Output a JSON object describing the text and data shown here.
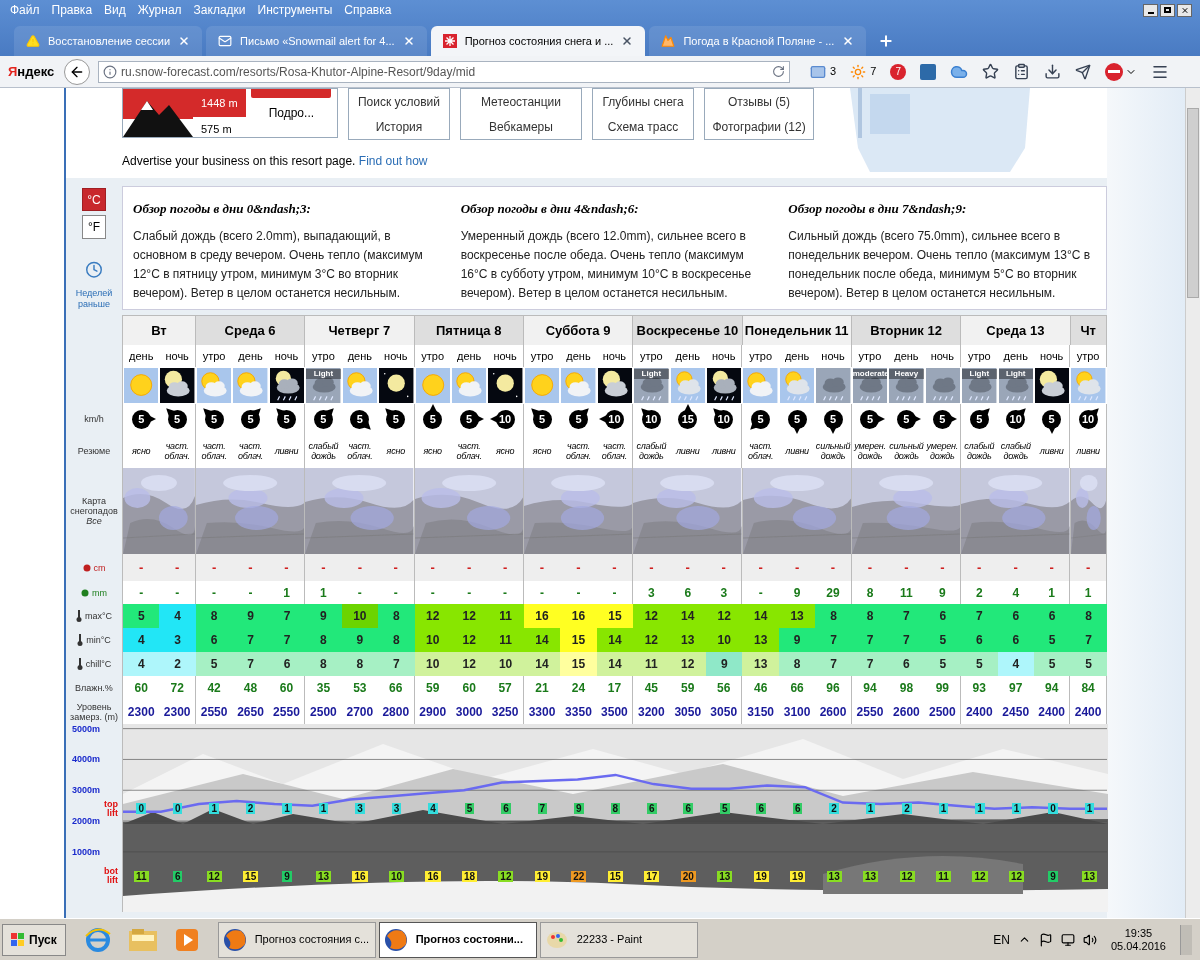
{
  "browser": {
    "menu": [
      "Файл",
      "Правка",
      "Вид",
      "Журнал",
      "Закладки",
      "Инструменты",
      "Справка"
    ],
    "tabs": [
      {
        "title": "Восстановление сессии",
        "selected": false
      },
      {
        "title": "Письмо «Snowmail alert for 4...",
        "selected": false
      },
      {
        "title": "Прогноз состояния снега и ...",
        "selected": true
      },
      {
        "title": "Погода в Красной Поляне - ...",
        "selected": false
      }
    ],
    "brand": "Яндекс",
    "url": "ru.snow-forecast.com/resorts/Rosa-Khutor-Alpine-Resort/9day/mid",
    "mail_count": "3",
    "weather_temp": "7",
    "notification_count": "7"
  },
  "resort": {
    "top_height": "1448 m",
    "bottom_height": "575 m",
    "more_link": "Подро...",
    "nav_boxes": [
      [
        "Поиск условий",
        "История"
      ],
      [
        "Метеостанции",
        "Вебкамеры"
      ],
      [
        "Глубины снега",
        "Схема трасс"
      ],
      [
        "Отзывы (5)",
        "Фотографии (12)"
      ]
    ],
    "advertise": "Advertise your business on this resort page.",
    "advertise_link": "Find out how"
  },
  "units": [
    {
      "label": "°C",
      "selected": true
    },
    {
      "label": "°F",
      "selected": false
    }
  ],
  "earlier_link": "Неделей раньше",
  "overview": [
    {
      "title": "Обзор погоды в дни 0&ndash;3:",
      "text": "Слабый дождь (всего 2.0mm), выпадающий, в основном в среду вечером. Очень тепло (максимум 12°C в пятницу утром, минимум 3°C во вторник вечером). Ветер в целом останется несильным."
    },
    {
      "title": "Обзор погоды в дни 4&ndash;6:",
      "text": "Умеренный дождь (всего 12.0mm), сильнее всего в воскресенье после обеда. Очень тепло (максимум 16°C в субботу утром, минимум 10°C в воскресенье вечером). Ветер в целом останется несильным."
    },
    {
      "title": "Обзор погоды в дни 7&ndash;9:",
      "text": "Сильный дождь (всего 75.0mm), сильнее всего в понедельник вечером. Очень тепло (максимум 13°C в понедельник после обеда, минимум 5°C во вторник вечером). Ветер в целом останется несильным."
    }
  ],
  "row_labels": {
    "wind": "km/h",
    "summary": "Резюме",
    "map": "Карта снегопадов",
    "map_link": "Все",
    "snow": "cm",
    "rain": "mm",
    "max": "max°C",
    "min": "min°C",
    "chill": "chill°C",
    "humidity": "Влажн.%",
    "freezing": "Уровень замерз. (m)"
  },
  "days": [
    {
      "name": "Вт",
      "slots": [
        {
          "period": "день",
          "kind": "sun",
          "wind": {
            "value": "5",
            "kind": "e"
          },
          "summary": "ясно",
          "snow": "-",
          "rain": "-",
          "max": {
            "value": "5",
            "color": "#22e87a"
          },
          "min": {
            "value": "4",
            "color": "#22e6f6"
          },
          "chill": {
            "value": "4",
            "color": "#aef6fb"
          },
          "humidity": "60",
          "freezing": "2300",
          "top_lift": {
            "value": "0",
            "color": "#33dddd"
          },
          "bot_lift": {
            "value": "11",
            "color": "#88dd22"
          }
        },
        {
          "period": "ночь",
          "kind": "moon_cloud",
          "wind": {
            "value": "5",
            "kind": "nw"
          },
          "summary": "част. облач.",
          "snow": "-",
          "rain": "-",
          "max": {
            "value": "4",
            "color": "#22e6f6"
          },
          "min": {
            "value": "3",
            "color": "#22e6f6"
          },
          "chill": {
            "value": "2",
            "color": "#aef6fb"
          },
          "humidity": "72",
          "freezing": "2300",
          "top_lift": {
            "value": "0",
            "color": "#33dddd"
          },
          "bot_lift": {
            "value": "6",
            "color": "#22cc66"
          }
        }
      ]
    },
    {
      "name": "Среда 6",
      "slots": [
        {
          "period": "утро",
          "kind": "sun_cloud",
          "wind": {
            "value": "5",
            "kind": "nw"
          },
          "summary": "част. облач.",
          "snow": "-",
          "rain": "-",
          "max": {
            "value": "8",
            "color": "#22e87a"
          },
          "min": {
            "value": "6",
            "color": "#22e87a"
          },
          "chill": {
            "value": "5",
            "color": "#a6f0c4"
          },
          "humidity": "42",
          "freezing": "2550",
          "top_lift": {
            "value": "1",
            "color": "#33dddd"
          },
          "bot_lift": {
            "value": "12",
            "color": "#88dd22"
          }
        },
        {
          "period": "день",
          "kind": "sun_cloud",
          "wind": {
            "value": "5",
            "kind": "ne"
          },
          "summary": "част. облач.",
          "snow": "-",
          "rain": "-",
          "max": {
            "value": "9",
            "color": "#22e87a"
          },
          "min": {
            "value": "7",
            "color": "#22e87a"
          },
          "chill": {
            "value": "7",
            "color": "#a6f0c4"
          },
          "humidity": "48",
          "freezing": "2650",
          "top_lift": {
            "value": "2",
            "color": "#33dddd"
          },
          "bot_lift": {
            "value": "15",
            "color": "#ffee33"
          }
        },
        {
          "period": "ночь",
          "kind": "moon_rain",
          "wind": {
            "value": "5",
            "kind": "nw"
          },
          "summary": "ливни",
          "snow": "-",
          "rain": "1",
          "max": {
            "value": "7",
            "color": "#22e87a"
          },
          "min": {
            "value": "7",
            "color": "#22e87a"
          },
          "chill": {
            "value": "6",
            "color": "#a6f0c4"
          },
          "humidity": "60",
          "freezing": "2550",
          "top_lift": {
            "value": "1",
            "color": "#33dddd"
          },
          "bot_lift": {
            "value": "9",
            "color": "#22cc66"
          }
        }
      ]
    },
    {
      "name": "Четверг 7",
      "slots": [
        {
          "period": "утро",
          "kind": "cloud_rain",
          "label": "Light",
          "wind": {
            "value": "5",
            "kind": "ne"
          },
          "summary": "слабый дождь",
          "snow": "-",
          "rain": "1",
          "max": {
            "value": "9",
            "color": "#22e87a"
          },
          "min": {
            "value": "8",
            "color": "#22e87a"
          },
          "chill": {
            "value": "8",
            "color": "#a6f0c4"
          },
          "humidity": "35",
          "freezing": "2500",
          "top_lift": {
            "value": "1",
            "color": "#33dddd"
          },
          "bot_lift": {
            "value": "13",
            "color": "#88dd22"
          }
        },
        {
          "period": "день",
          "kind": "sun_cloud",
          "wind": {
            "value": "5",
            "kind": "se"
          },
          "summary": "част. облач.",
          "snow": "-",
          "rain": "-",
          "max": {
            "value": "10",
            "color": "#6cd400"
          },
          "min": {
            "value": "9",
            "color": "#22e87a"
          },
          "chill": {
            "value": "8",
            "color": "#a6f0c4"
          },
          "humidity": "53",
          "freezing": "2700",
          "top_lift": {
            "value": "3",
            "color": "#33dddd"
          },
          "bot_lift": {
            "value": "16",
            "color": "#ffee33"
          }
        },
        {
          "period": "ночь",
          "kind": "moon",
          "wind": {
            "value": "5",
            "kind": "nw"
          },
          "summary": "ясно",
          "snow": "-",
          "rain": "-",
          "max": {
            "value": "8",
            "color": "#22e87a"
          },
          "min": {
            "value": "8",
            "color": "#22e87a"
          },
          "chill": {
            "value": "7",
            "color": "#a6f0c4"
          },
          "humidity": "66",
          "freezing": "2800",
          "top_lift": {
            "value": "3",
            "color": "#33dddd"
          },
          "bot_lift": {
            "value": "10",
            "color": "#88dd22"
          }
        }
      ]
    },
    {
      "name": "Пятница 8",
      "slots": [
        {
          "period": "утро",
          "kind": "sun",
          "wind": {
            "value": "5",
            "kind": "n"
          },
          "summary": "ясно",
          "snow": "-",
          "rain": "-",
          "max": {
            "value": "12",
            "color": "#88e600"
          },
          "min": {
            "value": "10",
            "color": "#88e600"
          },
          "chill": {
            "value": "10",
            "color": "#d0f29c"
          },
          "humidity": "59",
          "freezing": "2900",
          "top_lift": {
            "value": "4",
            "color": "#33dddd"
          },
          "bot_lift": {
            "value": "16",
            "color": "#ffee33"
          }
        },
        {
          "period": "день",
          "kind": "sun_cloud",
          "wind": {
            "value": "5",
            "kind": "e"
          },
          "summary": "част. облач.",
          "snow": "-",
          "rain": "-",
          "max": {
            "value": "12",
            "color": "#88e600"
          },
          "min": {
            "value": "12",
            "color": "#88e600"
          },
          "chill": {
            "value": "12",
            "color": "#d0f29c"
          },
          "humidity": "60",
          "freezing": "3000",
          "top_lift": {
            "value": "5",
            "color": "#33cc66"
          },
          "bot_lift": {
            "value": "18",
            "color": "#ffee33"
          }
        },
        {
          "period": "ночь",
          "kind": "moon",
          "wind": {
            "value": "10",
            "kind": "w"
          },
          "summary": "ясно",
          "snow": "-",
          "rain": "-",
          "max": {
            "value": "11",
            "color": "#88e600"
          },
          "min": {
            "value": "11",
            "color": "#88e600"
          },
          "chill": {
            "value": "10",
            "color": "#d0f29c"
          },
          "humidity": "57",
          "freezing": "3250",
          "top_lift": {
            "value": "6",
            "color": "#33cc66"
          },
          "bot_lift": {
            "value": "12",
            "color": "#88dd22"
          }
        }
      ]
    },
    {
      "name": "Суббота 9",
      "slots": [
        {
          "period": "утро",
          "kind": "sun",
          "wind": {
            "value": "5",
            "kind": "nw"
          },
          "summary": "ясно",
          "snow": "-",
          "rain": "-",
          "max": {
            "value": "16",
            "color": "#ffff22"
          },
          "min": {
            "value": "14",
            "color": "#88e600"
          },
          "chill": {
            "value": "14",
            "color": "#d0f29c"
          },
          "humidity": "21",
          "freezing": "3300",
          "top_lift": {
            "value": "7",
            "color": "#33cc66"
          },
          "bot_lift": {
            "value": "19",
            "color": "#ffee33"
          }
        },
        {
          "period": "день",
          "kind": "sun_cloud",
          "wind": {
            "value": "5",
            "kind": "ne"
          },
          "summary": "част. облач.",
          "snow": "-",
          "rain": "-",
          "max": {
            "value": "16",
            "color": "#ffff22"
          },
          "min": {
            "value": "15",
            "color": "#ffff22"
          },
          "chill": {
            "value": "15",
            "color": "#ffff9e"
          },
          "humidity": "24",
          "freezing": "3350",
          "top_lift": {
            "value": "9",
            "color": "#33cc66"
          },
          "bot_lift": {
            "value": "22",
            "color": "#ee9922"
          }
        },
        {
          "period": "ночь",
          "kind": "moon_cloud",
          "wind": {
            "value": "10",
            "kind": "w"
          },
          "summary": "част. облач.",
          "snow": "-",
          "rain": "-",
          "max": {
            "value": "15",
            "color": "#ffff22"
          },
          "min": {
            "value": "14",
            "color": "#88e600"
          },
          "chill": {
            "value": "14",
            "color": "#d0f29c"
          },
          "humidity": "17",
          "freezing": "3500",
          "top_lift": {
            "value": "8",
            "color": "#33cc66"
          },
          "bot_lift": {
            "value": "15",
            "color": "#ffee33"
          }
        }
      ]
    },
    {
      "name": "Воскресенье 10",
      "slots": [
        {
          "period": "утро",
          "kind": "cloud_rain",
          "label": "Light",
          "wind": {
            "value": "10",
            "kind": "nw"
          },
          "summary": "слабый дождь",
          "snow": "-",
          "rain": "3",
          "max": {
            "value": "12",
            "color": "#88e600"
          },
          "min": {
            "value": "12",
            "color": "#88e600"
          },
          "chill": {
            "value": "11",
            "color": "#d0f29c"
          },
          "humidity": "45",
          "freezing": "3200",
          "top_lift": {
            "value": "6",
            "color": "#33cc66"
          },
          "bot_lift": {
            "value": "17",
            "color": "#ffee33"
          }
        },
        {
          "period": "день",
          "kind": "sun_rain",
          "wind": {
            "value": "15",
            "kind": "n"
          },
          "summary": "ливни",
          "snow": "-",
          "rain": "6",
          "max": {
            "value": "14",
            "color": "#88e600"
          },
          "min": {
            "value": "13",
            "color": "#88e600"
          },
          "chill": {
            "value": "12",
            "color": "#d0f29c"
          },
          "humidity": "59",
          "freezing": "3050",
          "top_lift": {
            "value": "6",
            "color": "#33cc66"
          },
          "bot_lift": {
            "value": "20",
            "color": "#ee9922"
          }
        },
        {
          "period": "ночь",
          "kind": "moon_rain",
          "wind": {
            "value": "10",
            "kind": "nw"
          },
          "summary": "ливни",
          "snow": "-",
          "rain": "3",
          "max": {
            "value": "12",
            "color": "#88e600"
          },
          "min": {
            "value": "10",
            "color": "#88e600"
          },
          "chill": {
            "value": "9",
            "color": "#8fe8c8"
          },
          "humidity": "56",
          "freezing": "3050",
          "top_lift": {
            "value": "5",
            "color": "#33cc66"
          },
          "bot_lift": {
            "value": "13",
            "color": "#88dd22"
          }
        }
      ]
    },
    {
      "name": "Понедельник 11",
      "slots": [
        {
          "period": "утро",
          "kind": "sun_cloud",
          "wind": {
            "value": "5",
            "kind": "sw"
          },
          "summary": "част. облач.",
          "snow": "-",
          "rain": "-",
          "max": {
            "value": "14",
            "color": "#88e600"
          },
          "min": {
            "value": "13",
            "color": "#88e600"
          },
          "chill": {
            "value": "13",
            "color": "#d0f29c"
          },
          "humidity": "46",
          "freezing": "3150",
          "top_lift": {
            "value": "6",
            "color": "#33cc66"
          },
          "bot_lift": {
            "value": "19",
            "color": "#ffee33"
          }
        },
        {
          "period": "день",
          "kind": "sun_rain",
          "wind": {
            "value": "5",
            "kind": "s"
          },
          "summary": "ливни",
          "snow": "-",
          "rain": "9",
          "max": {
            "value": "13",
            "color": "#88e600"
          },
          "min": {
            "value": "9",
            "color": "#22e87a"
          },
          "chill": {
            "value": "8",
            "color": "#a6f0c4"
          },
          "humidity": "66",
          "freezing": "3100",
          "top_lift": {
            "value": "6",
            "color": "#33cc66"
          },
          "bot_lift": {
            "value": "19",
            "color": "#ffee33"
          }
        },
        {
          "period": "ночь",
          "kind": "cloud_rain",
          "wind": {
            "value": "5",
            "kind": "s"
          },
          "summary": "сильный дождь",
          "snow": "-",
          "rain": "29",
          "max": {
            "value": "8",
            "color": "#22e87a"
          },
          "min": {
            "value": "7",
            "color": "#22e87a"
          },
          "chill": {
            "value": "7",
            "color": "#a6f0c4"
          },
          "humidity": "96",
          "freezing": "2600",
          "top_lift": {
            "value": "2",
            "color": "#33dddd"
          },
          "bot_lift": {
            "value": "13",
            "color": "#88dd22"
          }
        }
      ]
    },
    {
      "name": "Вторник 12",
      "slots": [
        {
          "period": "утро",
          "kind": "cloud_rain",
          "label": "moderate",
          "wind": {
            "value": "5",
            "kind": "e"
          },
          "summary": "умерен. дождь",
          "snow": "-",
          "rain": "8",
          "max": {
            "value": "8",
            "color": "#22e87a"
          },
          "min": {
            "value": "7",
            "color": "#22e87a"
          },
          "chill": {
            "value": "7",
            "color": "#a6f0c4"
          },
          "humidity": "94",
          "freezing": "2550",
          "top_lift": {
            "value": "1",
            "color": "#33dddd"
          },
          "bot_lift": {
            "value": "13",
            "color": "#88dd22"
          }
        },
        {
          "period": "день",
          "kind": "cloud_rain",
          "label": "Heavy",
          "wind": {
            "value": "5",
            "kind": "e"
          },
          "summary": "сильный дождь",
          "snow": "-",
          "rain": "11",
          "max": {
            "value": "7",
            "color": "#22e87a"
          },
          "min": {
            "value": "7",
            "color": "#22e87a"
          },
          "chill": {
            "value": "6",
            "color": "#a6f0c4"
          },
          "humidity": "98",
          "freezing": "2600",
          "top_lift": {
            "value": "2",
            "color": "#33dddd"
          },
          "bot_lift": {
            "value": "12",
            "color": "#88dd22"
          }
        },
        {
          "period": "ночь",
          "kind": "cloud_rain",
          "wind": {
            "value": "5",
            "kind": "e"
          },
          "summary": "умерен. дождь",
          "snow": "-",
          "rain": "9",
          "max": {
            "value": "6",
            "color": "#22e87a"
          },
          "min": {
            "value": "5",
            "color": "#22e87a"
          },
          "chill": {
            "value": "5",
            "color": "#a6f0c4"
          },
          "humidity": "99",
          "freezing": "2500",
          "top_lift": {
            "value": "1",
            "color": "#33dddd"
          },
          "bot_lift": {
            "value": "11",
            "color": "#88dd22"
          }
        }
      ]
    },
    {
      "name": "Среда 13",
      "slots": [
        {
          "period": "утро",
          "kind": "cloud_rain",
          "label": "Light",
          "wind": {
            "value": "5",
            "kind": "ne"
          },
          "summary": "слабый дождь",
          "snow": "-",
          "rain": "2",
          "max": {
            "value": "7",
            "color": "#22e87a"
          },
          "min": {
            "value": "6",
            "color": "#22e87a"
          },
          "chill": {
            "value": "5",
            "color": "#a6f0c4"
          },
          "humidity": "93",
          "freezing": "2400",
          "top_lift": {
            "value": "1",
            "color": "#33dddd"
          },
          "bot_lift": {
            "value": "12",
            "color": "#88dd22"
          }
        },
        {
          "period": "день",
          "kind": "cloud_rain",
          "label": "Light",
          "wind": {
            "value": "10",
            "kind": "ne"
          },
          "summary": "слабый дождь",
          "snow": "-",
          "rain": "4",
          "max": {
            "value": "6",
            "color": "#22e87a"
          },
          "min": {
            "value": "6",
            "color": "#22e87a"
          },
          "chill": {
            "value": "4",
            "color": "#aef6fb"
          },
          "humidity": "97",
          "freezing": "2450",
          "top_lift": {
            "value": "1",
            "color": "#33dddd"
          },
          "bot_lift": {
            "value": "12",
            "color": "#88dd22"
          }
        },
        {
          "period": "ночь",
          "kind": "moon_cloud",
          "wind": {
            "value": "5",
            "kind": "s"
          },
          "summary": "ливни",
          "snow": "-",
          "rain": "1",
          "max": {
            "value": "6",
            "color": "#22e87a"
          },
          "min": {
            "value": "5",
            "color": "#22e87a"
          },
          "chill": {
            "value": "5",
            "color": "#a6f0c4"
          },
          "humidity": "94",
          "freezing": "2400",
          "top_lift": {
            "value": "0",
            "color": "#33dddd"
          },
          "bot_lift": {
            "value": "9",
            "color": "#22cc66"
          }
        }
      ]
    },
    {
      "name": "Чт",
      "slots": [
        {
          "period": "утро",
          "kind": "sun_rain",
          "wind": {
            "value": "10",
            "kind": "ne"
          },
          "summary": "ливни",
          "snow": "-",
          "rain": "1",
          "max": {
            "value": "8",
            "color": "#22e87a"
          },
          "min": {
            "value": "7",
            "color": "#22e87a"
          },
          "chill": {
            "value": "5",
            "color": "#a6f0c4"
          },
          "humidity": "84",
          "freezing": "2400",
          "top_lift": {
            "value": "1",
            "color": "#33dddd"
          },
          "bot_lift": {
            "value": "13",
            "color": "#88dd22"
          }
        }
      ]
    }
  ],
  "chart": {
    "top_lift_label": "top lift",
    "bot_lift_label": "bot lift",
    "chart_data": {
      "type": "line",
      "grid": true,
      "ylim": [
        -950,
        5150
      ],
      "yticks": [
        {
          "value": 5000,
          "label": "5000m"
        },
        {
          "value": 4000,
          "label": "4000m"
        },
        {
          "value": 3000,
          "label": "3000m"
        },
        {
          "value": 2000,
          "label": "2000m"
        },
        {
          "value": 1000,
          "label": "1000m"
        }
      ],
      "series": [
        {
          "color": "#6a6af0",
          "values": [
            2300,
            2300,
            2550,
            2650,
            2550,
            2500,
            2700,
            2800,
            2900,
            3000,
            3250,
            3300,
            3350,
            3500,
            3200,
            3050,
            3050,
            3150,
            3100,
            2600,
            2550,
            2600,
            2500,
            2400,
            2450,
            2400,
            2400
          ]
        }
      ]
    }
  },
  "taskbar": {
    "start": "Пуск",
    "tasks": [
      {
        "title": "Прогноз состояния с...",
        "selected": false
      },
      {
        "title": "Прогноз состояни...",
        "selected": true
      },
      {
        "title": "22233 - Paint",
        "selected": false
      }
    ],
    "language": "EN",
    "time": "19:35",
    "date": "05.04.2016"
  }
}
